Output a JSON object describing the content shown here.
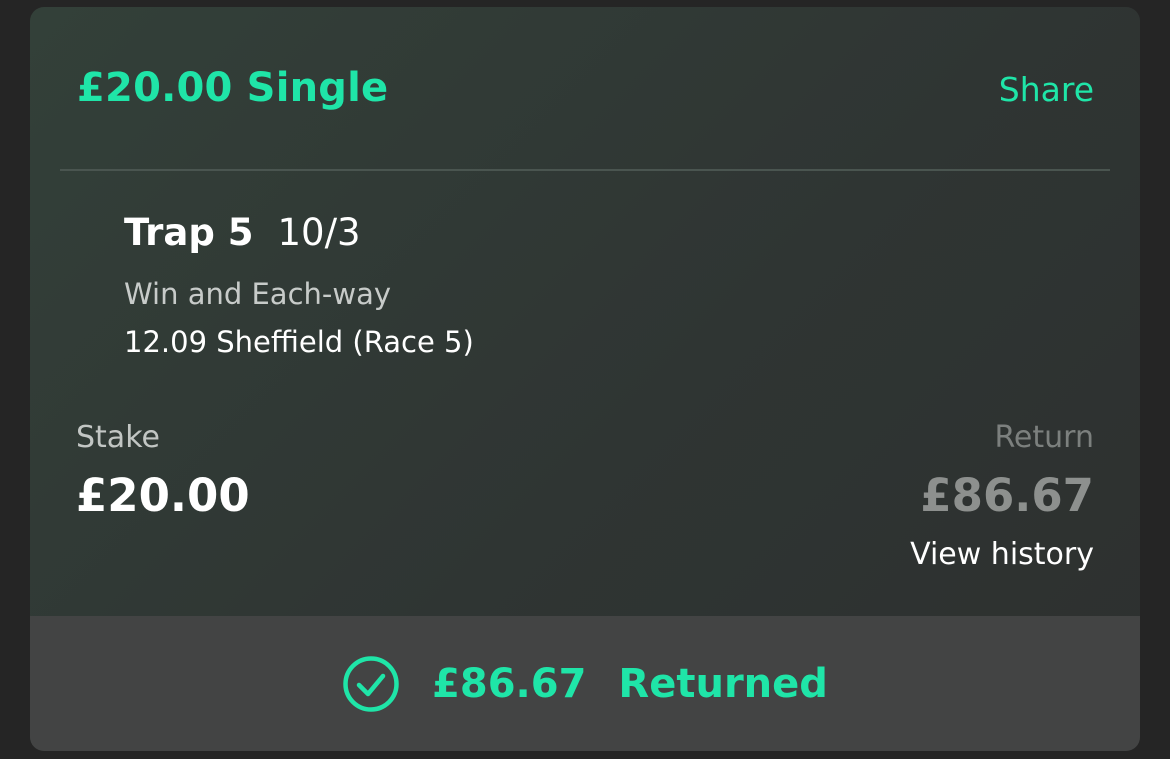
{
  "bet": {
    "title": "£20.00 Single",
    "share_label": "Share"
  },
  "selection": {
    "name": "Trap 5",
    "odds": "10/3",
    "market": "Win and Each-way",
    "event": "12.09 Sheffield (Race 5)"
  },
  "stake": {
    "label": "Stake",
    "value": "£20.00"
  },
  "return": {
    "label": "Return",
    "value": "£86.67",
    "history_link": "View history"
  },
  "footer": {
    "icon": "check-circle-icon",
    "amount": "£86.67",
    "status": "Returned"
  },
  "colors": {
    "accent": "#1fe5a8",
    "background": "#252525",
    "card": "#2f3533",
    "footer": "#434444"
  }
}
